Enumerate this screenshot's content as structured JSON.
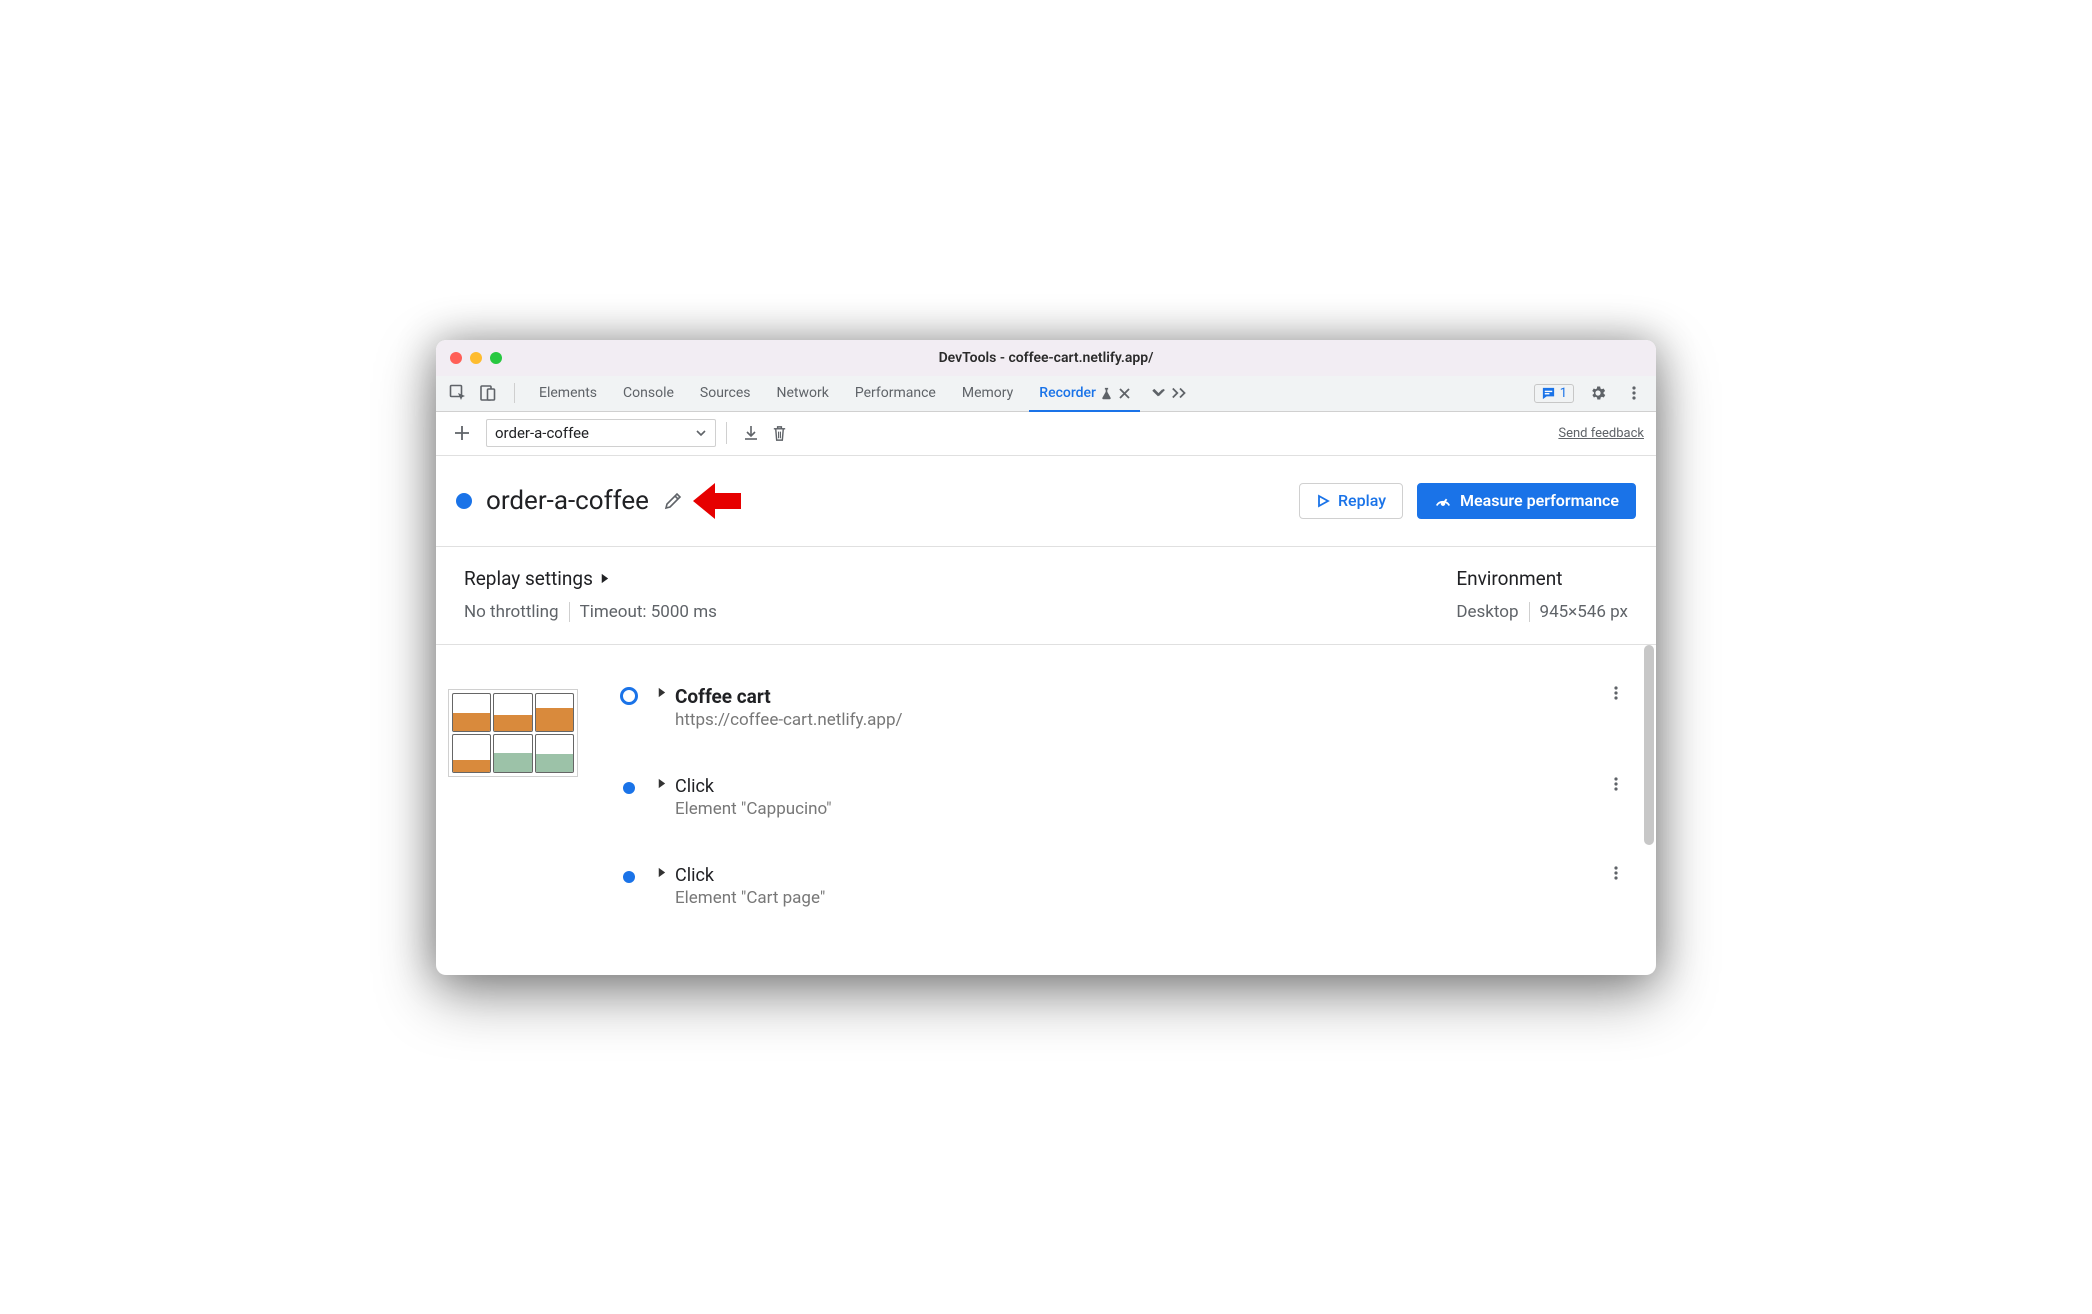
{
  "window": {
    "title": "DevTools - coffee-cart.netlify.app/"
  },
  "tabs": {
    "items": [
      "Elements",
      "Console",
      "Sources",
      "Network",
      "Performance",
      "Memory",
      "Recorder"
    ],
    "active_index": 6
  },
  "issues": {
    "count": "1"
  },
  "toolbar": {
    "recording_name": "order-a-coffee",
    "send_feedback": "Send feedback"
  },
  "header": {
    "title": "order-a-coffee",
    "replay_label": "Replay",
    "measure_label": "Measure performance"
  },
  "settings": {
    "replay_heading": "Replay settings",
    "throttling": "No throttling",
    "timeout": "Timeout: 5000 ms",
    "env_heading": "Environment",
    "env_device": "Desktop",
    "env_viewport": "945×546 px"
  },
  "steps": [
    {
      "title": "Coffee cart",
      "subtitle": "https://coffee-cart.netlify.app/"
    },
    {
      "title": "Click",
      "subtitle": "Element \"Cappucino\""
    },
    {
      "title": "Click",
      "subtitle": "Element \"Cart page\""
    }
  ]
}
